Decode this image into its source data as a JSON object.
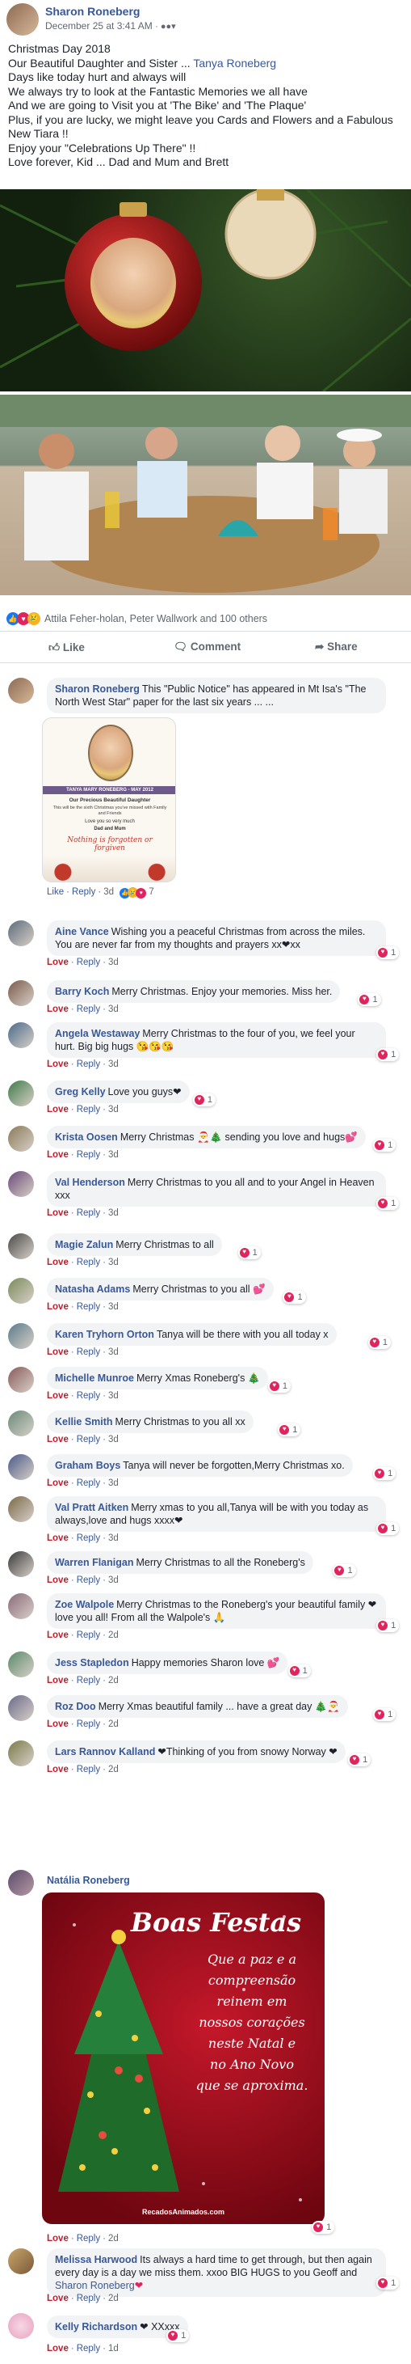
{
  "post": {
    "author": "Sharon Roneberg",
    "meta": "December 25 at 3:41 AM",
    "privacy_icon": "friends-icon",
    "lines": [
      "Christmas Day 2018",
      "Our Beautiful Daughter and Sister ... Tanya Roneberg",
      "Days like today hurt and always will",
      "We always try to look at the Fantastic Memories we all have",
      "And we are going to Visit you at 'The Bike' and 'The Plaque'",
      "Plus, if you are lucky, we might leave you Cards and Flowers and a Fabulous",
      "New Tiara !!",
      "Enjoy your \"Celebrations Up There\" !!",
      "Love forever, Kid ... Dad and Mum and Brett"
    ],
    "tag_name": "Tanya Roneberg",
    "reactions_text": "Attila Feher-holan, Peter Wallwork and 100 others",
    "like_label": "Like",
    "comment_label": "Comment",
    "share_label": "Share"
  },
  "first_comment": {
    "name": "Sharon Roneberg",
    "text": "This \"Public Notice\" has appeared in Mt Isa's \"The North West Star\" paper for the last six years ... ...",
    "card": {
      "header": "TANYA MARY RONEBERG - MAY 2012",
      "title": "Our Precious Beautiful Daughter",
      "body": "This will be the sixth Christmas you've missed with Family and Friends",
      "sign1": "Love you so very much",
      "sign2": "Dad and Mum",
      "script": "Nothing is forgotten or forgiven"
    },
    "like": "Like",
    "reply": "Reply",
    "time": "3d",
    "count": "7"
  },
  "comments": [
    {
      "name": "Aine Vance",
      "text": "Wishing you a peaceful Christmas from across the miles. You are never far from my thoughts and prayers xx❤xx",
      "time": "3d",
      "count": "1"
    },
    {
      "name": "Barry Koch",
      "text": "Merry Christmas. Enjoy your memories. Miss her.",
      "time": "3d",
      "count": "1"
    },
    {
      "name": "Angela Westaway",
      "text": "Merry Christmas to the four of you, we feel your hurt. Big big hugs 😘😘😘",
      "time": "3d",
      "count": "1"
    },
    {
      "name": "Greg Kelly",
      "text": "Love you guys❤",
      "time": "3d",
      "count": "1"
    },
    {
      "name": "Krista Oosen",
      "text": "Merry Christmas 🎅🎄 sending you love and hugs💕",
      "time": "3d",
      "count": "1"
    },
    {
      "name": "Val Henderson",
      "text": "Merry Christmas to you all and to your Angel in Heaven xxx",
      "time": "3d",
      "count": "1"
    },
    {
      "name": "Magie Zalun",
      "text": "Merry Christmas to all",
      "time": "3d",
      "count": "1"
    },
    {
      "name": "Natasha Adams",
      "text": "Merry Christmas to you all 💕",
      "time": "3d",
      "count": "1"
    },
    {
      "name": "Karen Tryhorn Orton",
      "text": "Tanya will be there with you all today x",
      "time": "3d",
      "count": "1"
    },
    {
      "name": "Michelle Munroe",
      "text": "Merry Xmas Roneberg's 🎄",
      "time": "3d",
      "count": "1"
    },
    {
      "name": "Kellie Smith",
      "text": "Merry Christmas to you all xx",
      "time": "3d",
      "count": "1"
    },
    {
      "name": "Graham Boys",
      "text": "Tanya will never be forgotten,Merry Christmas xo.",
      "time": "3d",
      "count": "1"
    },
    {
      "name": "Val Pratt Aitken",
      "text": "Merry xmas to you all,Tanya will be with you today as always,love and hugs xxxx❤",
      "time": "3d",
      "count": "1"
    },
    {
      "name": "Warren Flanigan",
      "text": "Merry Christmas to all the Roneberg's",
      "time": "3d",
      "count": "1"
    },
    {
      "name": "Zoe Walpole",
      "text": "Merry Christmas to the Roneberg's your beautiful family ❤ love you all! From all the Walpole's 🙏",
      "time": "2d",
      "count": "1"
    },
    {
      "name": "Jess Stapledon",
      "text": "Happy memories Sharon love 💕",
      "time": "2d",
      "count": "1"
    },
    {
      "name": "Roz Doo",
      "text": "Merry Xmas beautiful family ... have a great day 🎄🎅",
      "time": "2d",
      "count": "1"
    },
    {
      "name": "Lars Rannov Kalland",
      "text": "❤Thinking of you from snowy Norway ❤",
      "time": "2d",
      "count": "1"
    }
  ],
  "natalia": {
    "name": "Natália Roneberg",
    "card_title": "Boas Festas",
    "card_lines": [
      "Que a paz e a",
      "compreensão",
      "reinem em",
      "nossos corações",
      "neste Natal e",
      "no Ano Novo",
      "que se aproxima."
    ],
    "card_footer": "RecadosAnimados.com",
    "time": "2d",
    "count": "1"
  },
  "melissa": {
    "name": "Melissa Harwood",
    "text": "Its always a hard time to get through, but then again every day is a day we miss them. xxoo BIG HUGS to you Geoff and",
    "tag": "Sharon Roneberg",
    "heart": "❤",
    "time": "2d",
    "count": "1"
  },
  "kelly": {
    "name": "Kelly Richardson",
    "text": "❤ XXxxx",
    "time": "1d",
    "count": "1"
  },
  "labels": {
    "love": "Love",
    "reply": "Reply"
  },
  "colors": {
    "brand": "#385898",
    "love": "#e0245e",
    "bubble": "#f2f3f5"
  }
}
